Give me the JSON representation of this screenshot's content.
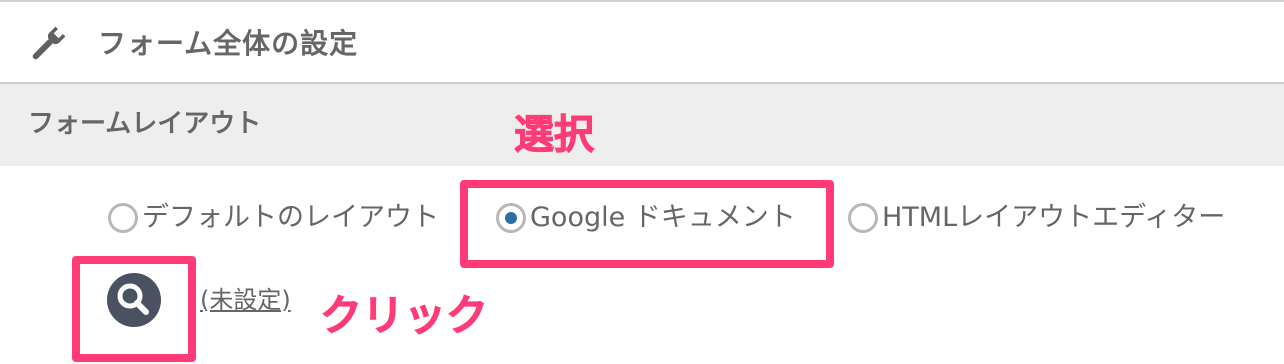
{
  "header": {
    "icon": "wrench-icon",
    "title": "フォーム全体の設定"
  },
  "section": {
    "title": "フォームレイアウト"
  },
  "layout_options": [
    {
      "label": "デフォルトのレイアウト",
      "checked": false
    },
    {
      "label": "Google ドキュメント",
      "checked": true
    },
    {
      "label": "HTMLレイアウトエディター",
      "checked": false
    }
  ],
  "document": {
    "search_icon": "search-icon",
    "status_link": "(未設定)"
  },
  "annotations": {
    "select_label": "選択",
    "click_label": "クリック",
    "color": "#ff3b77"
  },
  "colors": {
    "radio_selected": "#2a6fa8",
    "section_bg": "#eeeeee",
    "text": "#666666"
  }
}
